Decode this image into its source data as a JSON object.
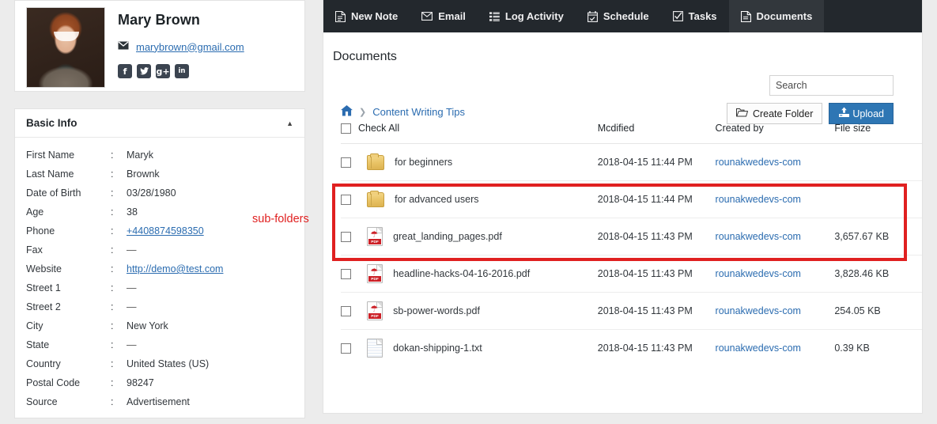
{
  "profile": {
    "name": "Mary Brown",
    "email": "marybrown@gmail.com",
    "email_icon": "envelope-icon",
    "avatar_alt": "portrait-photo",
    "social": [
      {
        "name": "facebook-icon",
        "glyph": "f"
      },
      {
        "name": "twitter-icon",
        "glyph": "ᴠ"
      },
      {
        "name": "google-plus-icon",
        "glyph": "g+"
      },
      {
        "name": "linkedin-icon",
        "glyph": "in"
      }
    ]
  },
  "basic_info": {
    "title": "Basic Info",
    "collapse_icon": "caret-up-icon",
    "fields": [
      {
        "label": "First Name",
        "colon": ":",
        "value": "Maryk",
        "type": "text"
      },
      {
        "label": "Last Name",
        "colon": ":",
        "value": "Brownk",
        "type": "text"
      },
      {
        "label": "Date of Birth",
        "colon": ":",
        "value": "03/28/1980",
        "type": "text"
      },
      {
        "label": "Age",
        "colon": ":",
        "value": "38",
        "type": "text"
      },
      {
        "label": "Phone",
        "colon": ":",
        "value": "+4408874598350",
        "type": "link"
      },
      {
        "label": "Fax",
        "colon": ":",
        "value": "—",
        "type": "dash"
      },
      {
        "label": "Website",
        "colon": ":",
        "value": "http://demo@test.com",
        "type": "link"
      },
      {
        "label": "Street 1",
        "colon": ":",
        "value": "—",
        "type": "dash"
      },
      {
        "label": "Street 2",
        "colon": ":",
        "value": "—",
        "type": "dash"
      },
      {
        "label": "City",
        "colon": ":",
        "value": "New York",
        "type": "text"
      },
      {
        "label": "State",
        "colon": ":",
        "value": "—",
        "type": "dash"
      },
      {
        "label": "Country",
        "colon": ":",
        "value": "United States (US)",
        "type": "text"
      },
      {
        "label": "Postal Code",
        "colon": ":",
        "value": "98247",
        "type": "text"
      },
      {
        "label": "Source",
        "colon": ":",
        "value": "Advertisement",
        "type": "text"
      }
    ]
  },
  "tabs": [
    {
      "label": "New Note",
      "icon": "note-icon",
      "active": false
    },
    {
      "label": "Email",
      "icon": "envelope-icon",
      "active": false
    },
    {
      "label": "Log Activity",
      "icon": "list-icon",
      "active": false
    },
    {
      "label": "Schedule",
      "icon": "calendar-icon",
      "active": false
    },
    {
      "label": "Tasks",
      "icon": "check-square-icon",
      "active": false
    },
    {
      "label": "Documents",
      "icon": "document-icon",
      "active": true
    }
  ],
  "documents": {
    "section_title": "Documents",
    "search_placeholder": "Search",
    "search_value": "",
    "create_folder_label": "Create Folder",
    "create_folder_icon": "folder-open-icon",
    "upload_label": "Upload",
    "upload_icon": "upload-icon",
    "breadcrumb": {
      "home_icon": "home-icon",
      "separator": "❯",
      "current": "Content Writing Tips"
    },
    "columns": [
      "Check All",
      "Mcdified",
      "Created by",
      "File size"
    ],
    "rows": [
      {
        "icon": "folder-icon",
        "name": "for beginners",
        "modified": "2018-04-15 11:44 PM",
        "created_by": "rounakwedevs-com",
        "size": ""
      },
      {
        "icon": "folder-icon",
        "name": "for advanced users",
        "modified": "2018-04-15 11:44 PM",
        "created_by": "rounakwedevs-com",
        "size": ""
      },
      {
        "icon": "pdf-icon",
        "name": "great_landing_pages.pdf",
        "modified": "2018-04-15 11:43 PM",
        "created_by": "rounakwedevs-com",
        "size": "3,657.67 KB"
      },
      {
        "icon": "pdf-icon",
        "name": "headline-hacks-04-16-2016.pdf",
        "modified": "2018-04-15 11:43 PM",
        "created_by": "rounakwedevs-com",
        "size": "3,828.46 KB"
      },
      {
        "icon": "pdf-icon",
        "name": "sb-power-words.pdf",
        "modified": "2018-04-15 11:43 PM",
        "created_by": "rounakwedevs-com",
        "size": "254.05 KB"
      },
      {
        "icon": "text-file-icon",
        "name": "dokan-shipping-1.txt",
        "modified": "2018-04-15 11:43 PM",
        "created_by": "rounakwedevs-com",
        "size": "0.39 KB"
      }
    ],
    "pdf_badge": "PDF"
  },
  "annotations": {
    "sub_folders_label": "sub-folders",
    "highlight_color": "#e02020"
  },
  "colors": {
    "accent_blue": "#2e76b4",
    "link_blue": "#2b6cb0",
    "tabbar_dark": "#23282d",
    "tab_active": "#32373c",
    "page_bg": "#ececec"
  }
}
